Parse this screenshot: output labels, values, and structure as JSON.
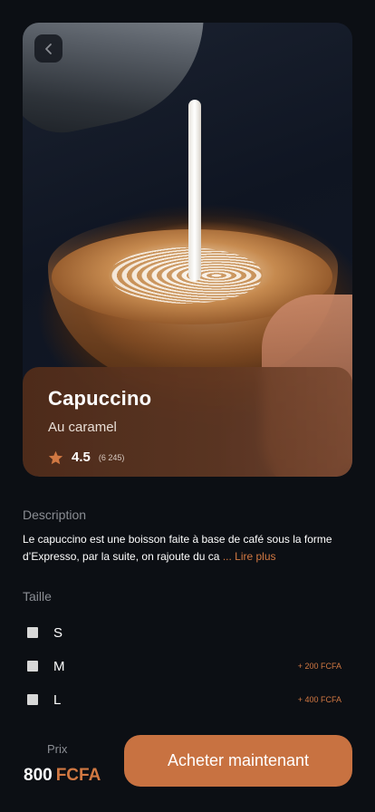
{
  "product": {
    "name": "Capuccino",
    "subtitle": "Au caramel",
    "rating": "4.5",
    "rating_count": "(6 245)"
  },
  "description": {
    "label": "Description",
    "text": "Le capuccino est une boisson faite à base de café sous la forme d’Expresso, par la suite, on rajoute du ca",
    "read_more": "... Lire plus"
  },
  "sizes": {
    "label": "Taille",
    "options": [
      {
        "label": "S",
        "extra": ""
      },
      {
        "label": "M",
        "extra": "+ 200 FCFA"
      },
      {
        "label": "L",
        "extra": "+ 400 FCFA"
      }
    ]
  },
  "footer": {
    "price_label": "Prix",
    "price_value": "800",
    "price_currency": "FCFA",
    "buy_label": "Acheter maintenant"
  },
  "icons": {
    "back": "chevron-left-icon",
    "rating": "star-icon"
  },
  "colors": {
    "accent": "#d17842",
    "button": "#c87241",
    "background": "#0c0f14",
    "muted_text": "#8a8d93"
  }
}
